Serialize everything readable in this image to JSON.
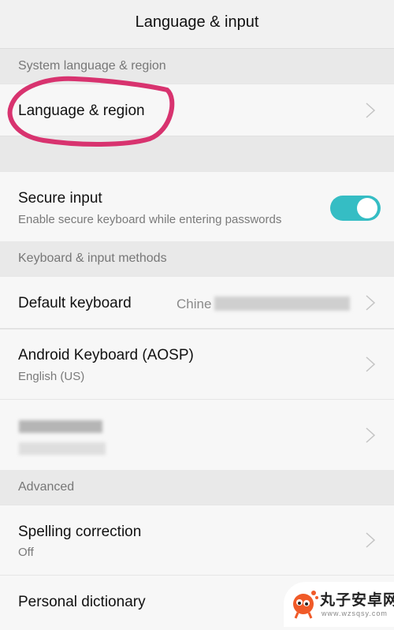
{
  "header": {
    "title": "Language & input"
  },
  "sections": {
    "system": "System language & region",
    "keyboard": "Keyboard & input methods",
    "advanced": "Advanced"
  },
  "rows": {
    "language_region": {
      "label": "Language & region"
    },
    "secure_input": {
      "label": "Secure input",
      "description": "Enable secure keyboard while entering passwords",
      "enabled": true
    },
    "default_keyboard": {
      "label": "Default keyboard",
      "value": "Chinese (blurred)",
      "value_visible": "Chine"
    },
    "android_keyboard": {
      "label": "Android Keyboard (AOSP)",
      "description": "English (US)"
    },
    "blurred_keyboard": {
      "label": "(blurred)",
      "description": "(blurred)"
    },
    "spelling_correction": {
      "label": "Spelling correction",
      "description": "Off"
    },
    "personal_dictionary": {
      "label": "Personal dictionary"
    }
  },
  "colors": {
    "toggle_on": "#35bdc4",
    "annotation": "#d8336f"
  },
  "watermark": {
    "name": "丸子安卓网",
    "url": "www.wzsqsy.com"
  }
}
